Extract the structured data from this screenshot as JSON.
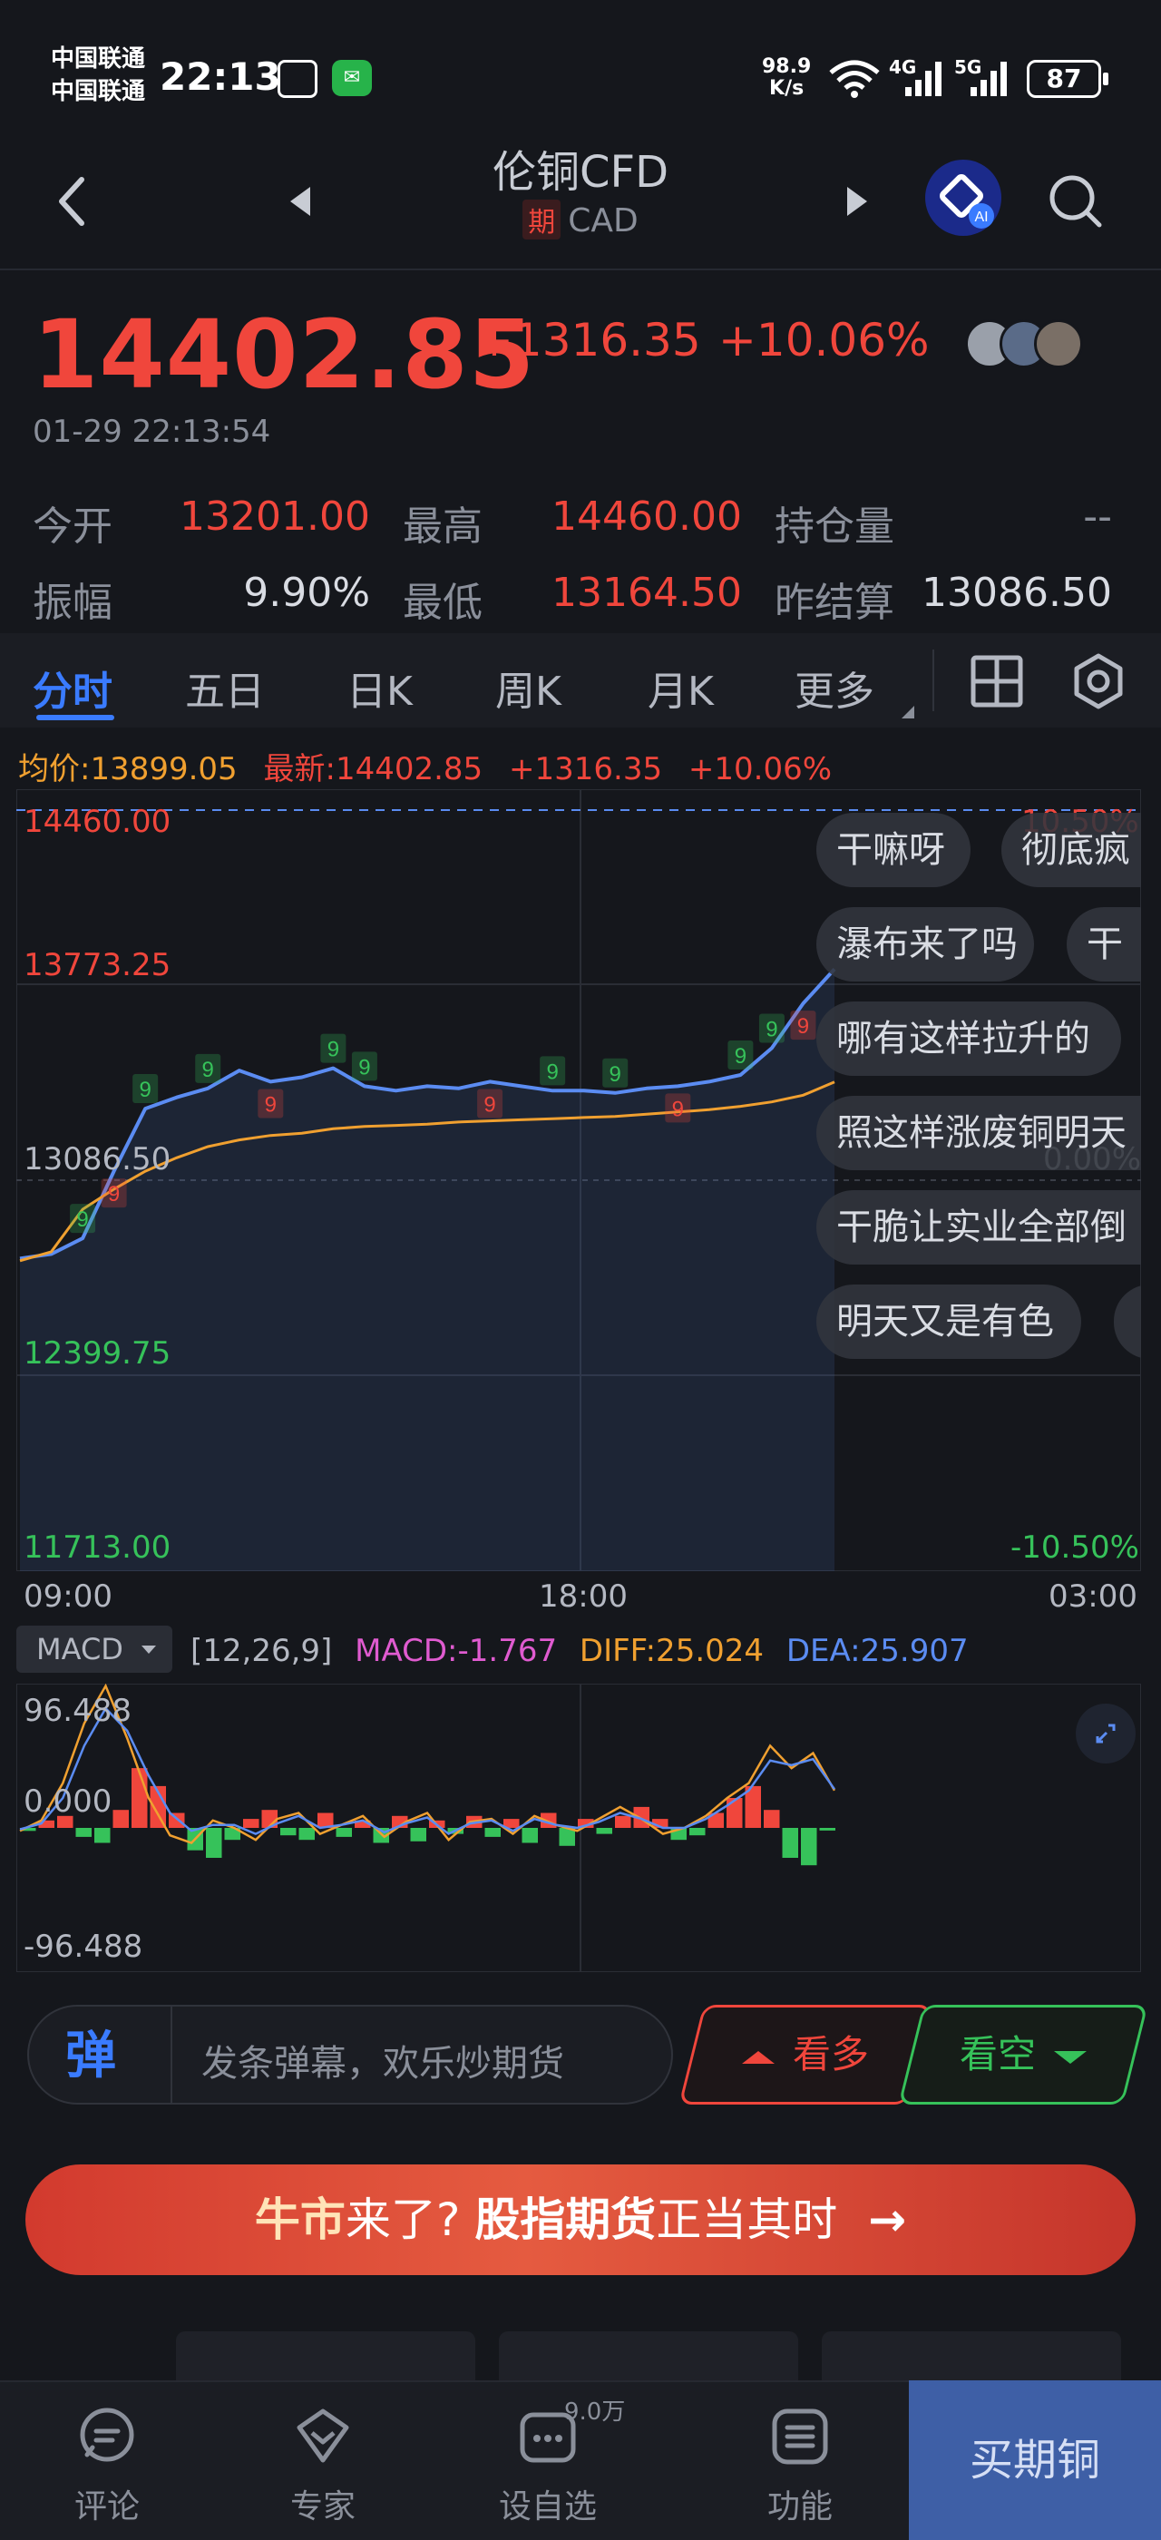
{
  "status_bar": {
    "carrier1": "中国联通",
    "carrier2": "中国联通",
    "time": "22:13",
    "net_speed_value": "98.9",
    "net_speed_unit": "K/s",
    "sig1": "4G",
    "sig2": "5G",
    "battery": "87"
  },
  "header": {
    "title": "伦铜CFD",
    "badge": "期",
    "subtitle": "CAD"
  },
  "quote": {
    "price": "14402.85",
    "change": "+1316.35",
    "change_pct": "+10.06%",
    "timestamp": "01-29 22:13:54",
    "stats": {
      "open_label": "今开",
      "open_value": "13201.00",
      "high_label": "最高",
      "high_value": "14460.00",
      "oi_label": "持仓量",
      "oi_value": "--",
      "amp_label": "振幅",
      "amp_value": "9.90%",
      "low_label": "最低",
      "low_value": "13164.50",
      "prev_label": "昨结算",
      "prev_value": "13086.50"
    }
  },
  "tabs": [
    "分时",
    "五日",
    "日K",
    "周K",
    "月K",
    "更多"
  ],
  "legend": {
    "avg": "均价:13899.05",
    "latest": "最新:14402.85",
    "change": "+1316.35",
    "change_pct": "+10.06%"
  },
  "chart_axes": {
    "y_labels": [
      "14460.00",
      "13773.25",
      "13086.50",
      "12399.75",
      "11713.00"
    ],
    "right_labels": [
      "10.50%",
      "0.00%",
      "-10.50%"
    ],
    "x_labels": [
      "09:00",
      "18:00",
      "03:00"
    ],
    "marker": "9"
  },
  "danmaku": [
    "干嘛呀",
    "彻底疯",
    "瀑布来了吗",
    "干",
    "哪有这样拉升的",
    "照这样涨废铜明天",
    "干脆让实业全部倒",
    "明天又是有色"
  ],
  "macd": {
    "selector": "MACD",
    "params": "[12,26,9]",
    "macd": "MACD:-1.767",
    "diff": "DIFF:25.024",
    "dea": "DEA:25.907",
    "y_labels": [
      "96.488",
      "0.000",
      "-96.488"
    ]
  },
  "bottom": {
    "dan_icon": "弹",
    "comment_placeholder": "发条弹幕，欢乐炒期货",
    "bull": "看多",
    "bear": "看空",
    "banner_a": "牛市",
    "banner_b": "来了?",
    "banner_c": "股指期货",
    "banner_d": "正当其时",
    "banner_arrow": "→"
  },
  "tabbar": {
    "items": [
      "评论",
      "专家",
      "设自选",
      "功能"
    ],
    "badge": "9.0万",
    "buy": "买期铜"
  },
  "colors": {
    "up": "#f0463c",
    "down": "#36c25a",
    "accent": "#3a7bff",
    "avg_line": "#f0a030",
    "price_line": "#5b8cf2"
  },
  "chart_data": [
    {
      "type": "line",
      "ylim": [
        11713.0,
        15207.0
      ],
      "x": [
        "09:00",
        "18:00",
        "03:00"
      ],
      "series": [
        {
          "values": [
            13110,
            13130,
            13200,
            13500,
            13780,
            13830,
            13870,
            13950,
            13900,
            13920,
            13960,
            13880,
            13860,
            13880,
            13870,
            13900,
            13880,
            13860,
            13860,
            13850,
            13870,
            13880,
            13900,
            13930,
            14050,
            14250,
            14402.85
          ]
        },
        {
          "values": [
            13100,
            13140,
            13330,
            13420,
            13500,
            13560,
            13610,
            13640,
            13660,
            13670,
            13690,
            13700,
            13705,
            13710,
            13720,
            13725,
            13730,
            13735,
            13740,
            13745,
            13755,
            13765,
            13775,
            13790,
            13810,
            13840,
            13899.05
          ]
        }
      ]
    },
    {
      "type": "bar",
      "ylim": [
        -96.488,
        96.488
      ],
      "series": [
        {
          "name": "MACD",
          "values": [
            -2,
            5,
            8,
            -6,
            -10,
            12,
            40,
            28,
            10,
            -15,
            -20,
            -8,
            6,
            12,
            -5,
            -8,
            10,
            -6,
            5,
            -10,
            8,
            -9,
            5,
            -4,
            8,
            -6,
            6,
            -10,
            10,
            -12,
            6,
            -4,
            8,
            14,
            6,
            -8,
            -5,
            10,
            20,
            28,
            12,
            -20,
            -25,
            -1.767
          ]
        },
        {
          "name": "DIFF",
          "values": [
            -2,
            5,
            30,
            70,
            95,
            60,
            20,
            -5,
            -10,
            5,
            0,
            -8,
            6,
            10,
            -4,
            2,
            8,
            -6,
            4,
            10,
            -8,
            4,
            6,
            -4,
            8,
            2,
            -2,
            6,
            14,
            6,
            -4,
            0,
            8,
            20,
            30,
            55,
            40,
            50,
            25.024
          ]
        },
        {
          "name": "DEA",
          "values": [
            -1,
            3,
            20,
            55,
            80,
            65,
            35,
            10,
            -2,
            2,
            2,
            -4,
            3,
            8,
            0,
            2,
            5,
            -3,
            3,
            7,
            -4,
            3,
            5,
            -2,
            6,
            2,
            0,
            4,
            10,
            6,
            0,
            0,
            6,
            15,
            25,
            45,
            42,
            46,
            25.907
          ]
        }
      ]
    }
  ]
}
